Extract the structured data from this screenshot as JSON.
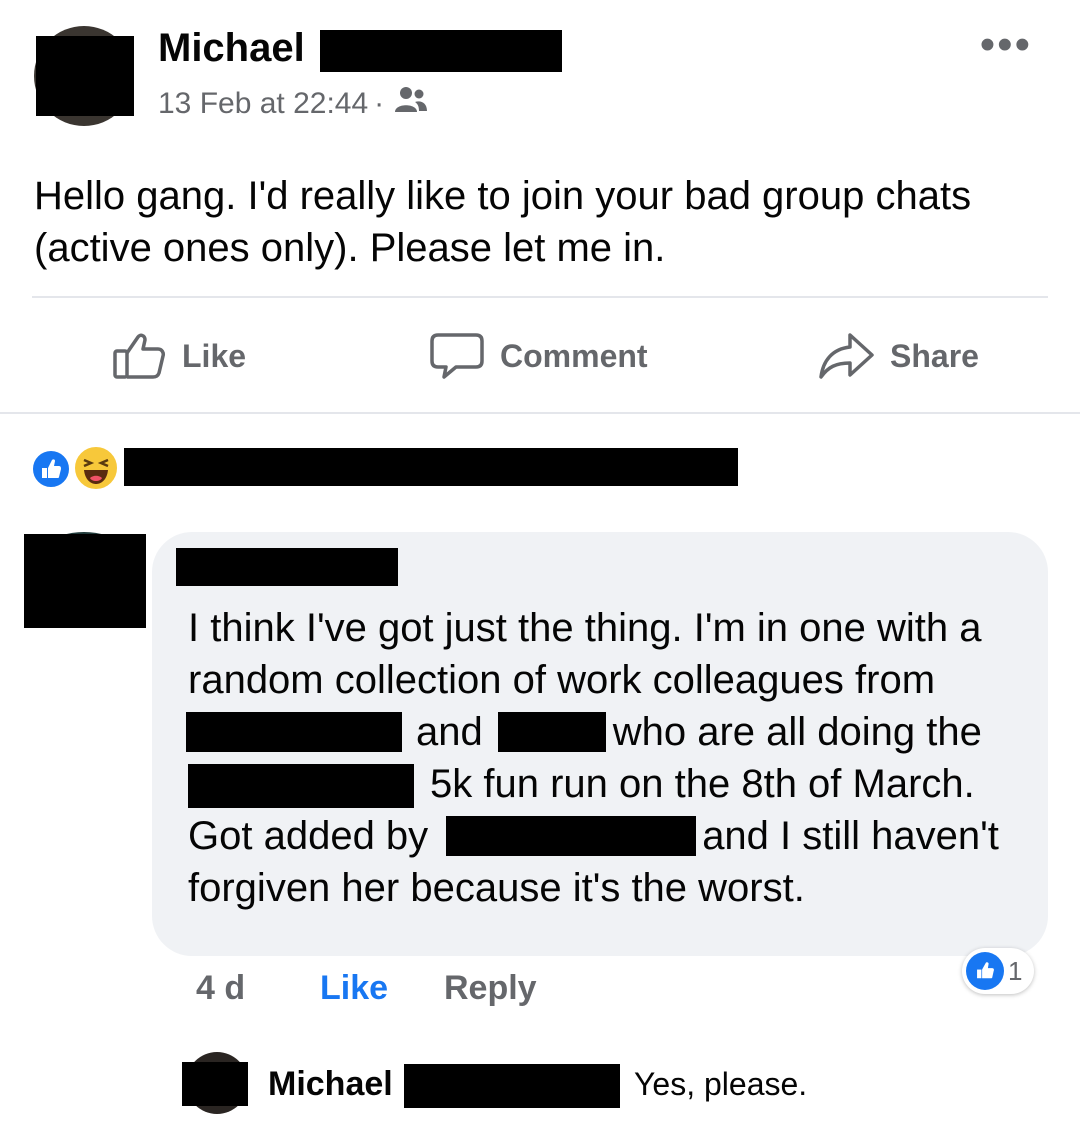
{
  "post": {
    "author_name": "Michael",
    "timestamp": "13 Feb at 22:44",
    "audience_icon": "group-icon",
    "text": "Hello gang. I'd really like to join your bad group chats (active ones only). Please let me in.",
    "more_label": "•••"
  },
  "actions": {
    "like_label": "Like",
    "comment_label": "Comment",
    "share_label": "Share"
  },
  "reactions": {
    "types": [
      "like",
      "haha"
    ],
    "colors": {
      "like": "#1877f2",
      "haha": "#f7c83a"
    }
  },
  "comment": {
    "lines": [
      {
        "a": "I think I've got just the thing. I'm in one with a"
      },
      {
        "a": "random collection of work colleagues from"
      },
      {
        "a": "and",
        "b": "who are all doing the"
      },
      {
        "a": "5k fun run on the 8th of March."
      },
      {
        "a": "Got added by",
        "b": "and I still haven't"
      },
      {
        "a": "forgiven her because it's the worst."
      }
    ],
    "age": "4 d",
    "like_label": "Like",
    "reply_label": "Reply",
    "like_count": "1"
  },
  "reply": {
    "author_name": "Michael",
    "text": "Yes, please."
  },
  "colors": {
    "accent": "#1877f2",
    "secondary_text": "#65676b",
    "bubble": "#f0f2f5"
  }
}
